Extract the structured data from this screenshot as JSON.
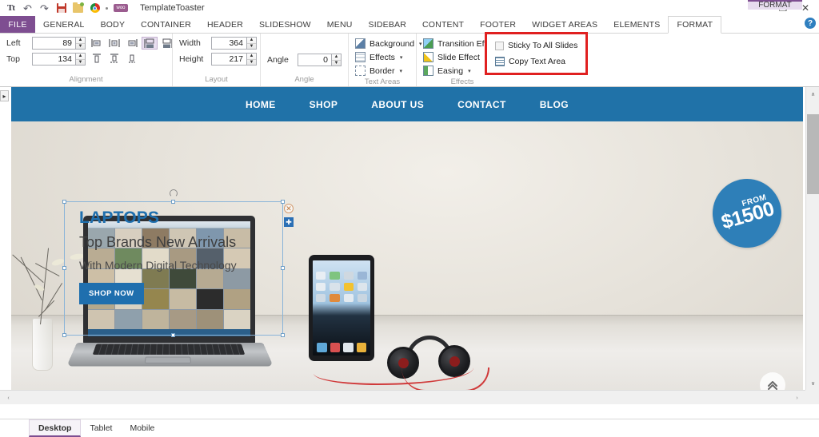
{
  "titlebar": {
    "app_title": "TemplateToaster",
    "quick_access": [
      {
        "name": "text-tool-icon",
        "label": "Tt"
      },
      {
        "name": "undo-icon",
        "label": "↶"
      },
      {
        "name": "redo-icon",
        "label": "↶"
      },
      {
        "name": "save-icon",
        "label": ""
      },
      {
        "name": "open-folder-icon",
        "label": ""
      },
      {
        "name": "chrome-preview-icon",
        "label": ""
      },
      {
        "name": "separator-dot",
        "label": ""
      },
      {
        "name": "woocommerce-icon",
        "label": "woo"
      }
    ],
    "window_controls": {
      "minimize": "—",
      "restore": "❐",
      "close": "✕",
      "help": "?"
    }
  },
  "ribbon_tabs": {
    "file": "FILE",
    "items": [
      "GENERAL",
      "BODY",
      "CONTAINER",
      "HEADER",
      "SLIDESHOW",
      "MENU",
      "SIDEBAR",
      "CONTENT",
      "FOOTER",
      "WIDGET AREAS",
      "ELEMENTS"
    ],
    "contextual_header": "FORMAT",
    "active_tab": "FORMAT"
  },
  "ribbon": {
    "alignment": {
      "title": "Alignment",
      "left_label": "Left",
      "left_value": "89",
      "top_label": "Top",
      "top_value": "134",
      "buttons": [
        {
          "name": "align-left-button",
          "glyph": "align-left",
          "active": false
        },
        {
          "name": "align-center-horizontal-button",
          "glyph": "align-center-h",
          "active": false
        },
        {
          "name": "align-right-button",
          "glyph": "align-right",
          "active": false
        },
        {
          "name": "distribute-left-button",
          "glyph": "dist-left",
          "active": true
        },
        {
          "name": "distribute-right-button",
          "glyph": "dist-right",
          "active": false
        },
        {
          "name": "align-top-button",
          "glyph": "align-top",
          "active": false
        },
        {
          "name": "align-middle-button",
          "glyph": "align-middle",
          "active": false
        },
        {
          "name": "align-bottom-button",
          "glyph": "align-bottom",
          "active": false
        }
      ]
    },
    "layout": {
      "title": "Layout",
      "width_label": "Width",
      "width_value": "364",
      "height_label": "Height",
      "height_value": "217"
    },
    "angle": {
      "title": "Angle",
      "angle_label": "Angle",
      "angle_value": "0"
    },
    "text_areas": {
      "title": "Text Areas",
      "items": [
        {
          "name": "background-menu",
          "label": "Background",
          "icon": "background-icon",
          "arrow": "▾"
        },
        {
          "name": "effects-menu",
          "label": "Effects",
          "icon": "effects-icon",
          "arrow": "▾"
        },
        {
          "name": "border-menu",
          "label": "Border",
          "icon": "border-icon",
          "arrow": "▾"
        }
      ]
    },
    "effects": {
      "title": "Effects",
      "items": [
        {
          "name": "transition-effects-menu",
          "label": "Transition Effects",
          "icon": "transition-effects-icon",
          "arrow": "▾"
        },
        {
          "name": "slide-effect-menu",
          "label": "Slide Effect",
          "icon": "slide-effect-icon",
          "arrow": "▾"
        },
        {
          "name": "easing-menu",
          "label": "Easing",
          "icon": "easing-icon",
          "arrow": "▾"
        }
      ]
    },
    "callout": {
      "highlight_color": "#e02020",
      "items": [
        {
          "name": "sticky-to-all-slides-checkbox",
          "label": "Sticky To All Slides",
          "icon": "checkbox-icon",
          "checked": false
        },
        {
          "name": "copy-text-area-button",
          "label": "Copy Text Area",
          "icon": "copy-text-area-icon"
        }
      ]
    }
  },
  "canvas": {
    "expander_icon": "▸",
    "navbar": {
      "background_color": "#2072a8",
      "links": [
        "HOME",
        "SHOP",
        "ABOUT US",
        "CONTACT",
        "BLOG"
      ]
    },
    "hero": {
      "heading": "LAPTOPS",
      "subheading": "Top Brands New Arrivals",
      "tagline": "With Modern Digital Technology",
      "cta_label": "SHOP NOW",
      "heading_color": "#1f6fae",
      "badge": {
        "from_label": "FROM",
        "amount": "$1500",
        "color": "#2e7fb8"
      },
      "slide_dots": [
        {
          "name": "slide-dot-1",
          "active": true
        },
        {
          "name": "slide-dot-2",
          "active": false
        }
      ],
      "scroll_top_icon": "«"
    },
    "selection": {
      "rotate_handle": "rotate-handle",
      "delete_badge": "✕",
      "add_badge": "✚"
    },
    "scrollbars": {
      "up_arrow": "∧",
      "down_arrow": "∨",
      "left_arrow": "‹",
      "right_arrow": "›"
    }
  },
  "bottom_tabs": {
    "items": [
      "Desktop",
      "Tablet",
      "Mobile"
    ],
    "active": "Desktop"
  }
}
